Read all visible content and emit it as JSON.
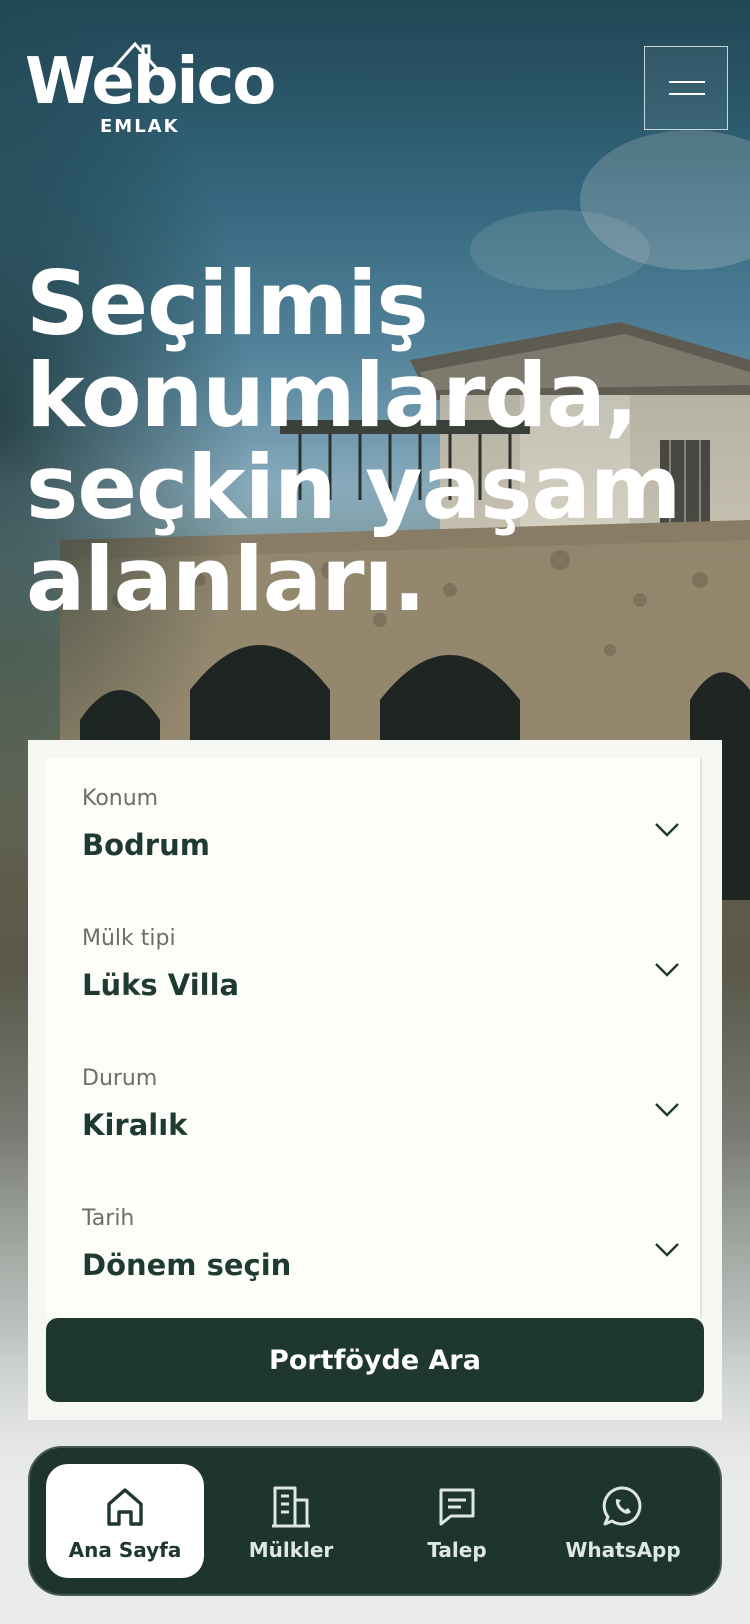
{
  "header": {
    "logo_word": "Webico",
    "logo_sub": "EMLAK",
    "menu_icon": "hamburger-icon"
  },
  "hero": {
    "headline_lines": [
      "Seçilmiş",
      "konumlarda,",
      "seçkin yaşam",
      "alanları."
    ]
  },
  "search": {
    "fields": [
      {
        "label": "Konum",
        "value": "Bodrum",
        "icon": "chevron-down-icon"
      },
      {
        "label": "Mülk tipi",
        "value": "Lüks Villa",
        "icon": "chevron-down-icon"
      },
      {
        "label": "Durum",
        "value": "Kiralık",
        "icon": "chevron-down-icon"
      },
      {
        "label": "Tarih",
        "value": "Dönem seçin",
        "icon": "chevron-down-icon"
      }
    ],
    "button_label": "Portföyde Ara"
  },
  "bottom_nav": {
    "items": [
      {
        "label": "Ana Sayfa",
        "icon": "home-icon",
        "active": true
      },
      {
        "label": "Mülkler",
        "icon": "building-icon",
        "active": false
      },
      {
        "label": "Talep",
        "icon": "message-icon",
        "active": false
      },
      {
        "label": "WhatsApp",
        "icon": "whatsapp-icon",
        "active": false
      }
    ]
  },
  "colors": {
    "brand_dark": "#1f382e",
    "card_bg": "#fdfdfa",
    "label_gray": "#6b6f6c"
  }
}
